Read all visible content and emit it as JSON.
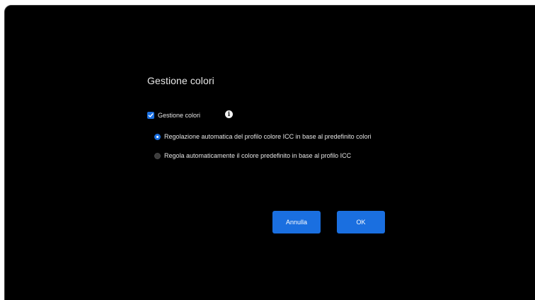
{
  "dialog": {
    "title": "Gestione colori",
    "color_management": {
      "label": "Gestione colori",
      "checked": true,
      "info_icon": "info-icon"
    },
    "options": [
      {
        "label": "Regolazione automatica del profilo colore ICC in base al predefinito colori",
        "selected": true
      },
      {
        "label": "Regola automaticamente il colore predefinito in base al profilo ICC",
        "selected": false
      }
    ],
    "buttons": {
      "cancel": "Annulla",
      "ok": "OK"
    }
  },
  "colors": {
    "accent": "#1a6fe0",
    "background": "#000000",
    "text": "#e6e6e6"
  }
}
